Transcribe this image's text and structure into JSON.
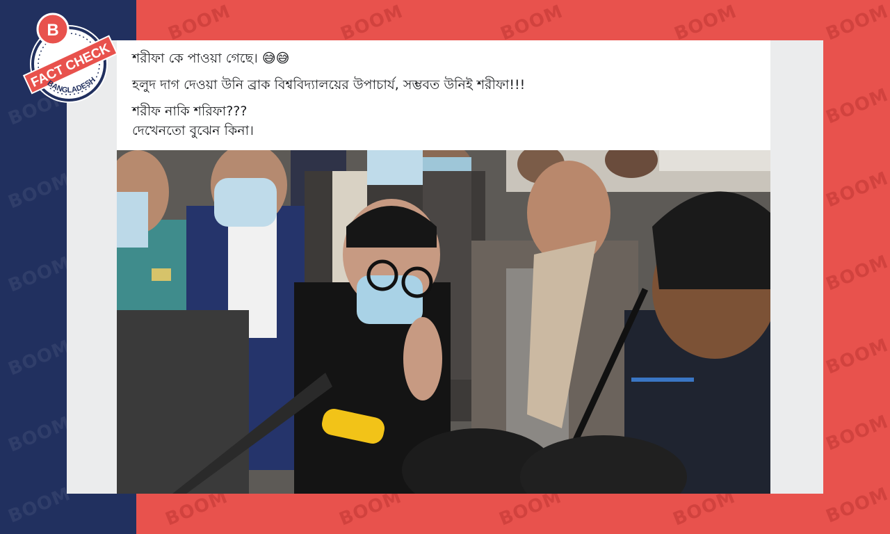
{
  "background": {
    "left_color": "#21305f",
    "right_color": "#e8524d",
    "watermark_text": "BOOM"
  },
  "badge": {
    "logo_letter": "B",
    "ribbon_text": "FACT CHECK",
    "ring_text": "BANGLADESH",
    "colors": {
      "ribbon": "#e8524d",
      "navy": "#21305f",
      "white": "#ffffff"
    }
  },
  "post": {
    "line1": "শরীফা কে পাওয়া গেছে।",
    "line1_emoji": "😅😅",
    "line2": "হলুদ দাগ দেওয়া উনি ব্রাক বিশ্ববিদ্যালয়ের উপাচার্য, সম্ভবত উনিই শরীফা!!!",
    "line3": "শরীফ নাকি শরিফা???",
    "line4": "দেখেনতো বুঝেন কিনা।"
  },
  "photo": {
    "highlight_color": "#f2c318"
  }
}
